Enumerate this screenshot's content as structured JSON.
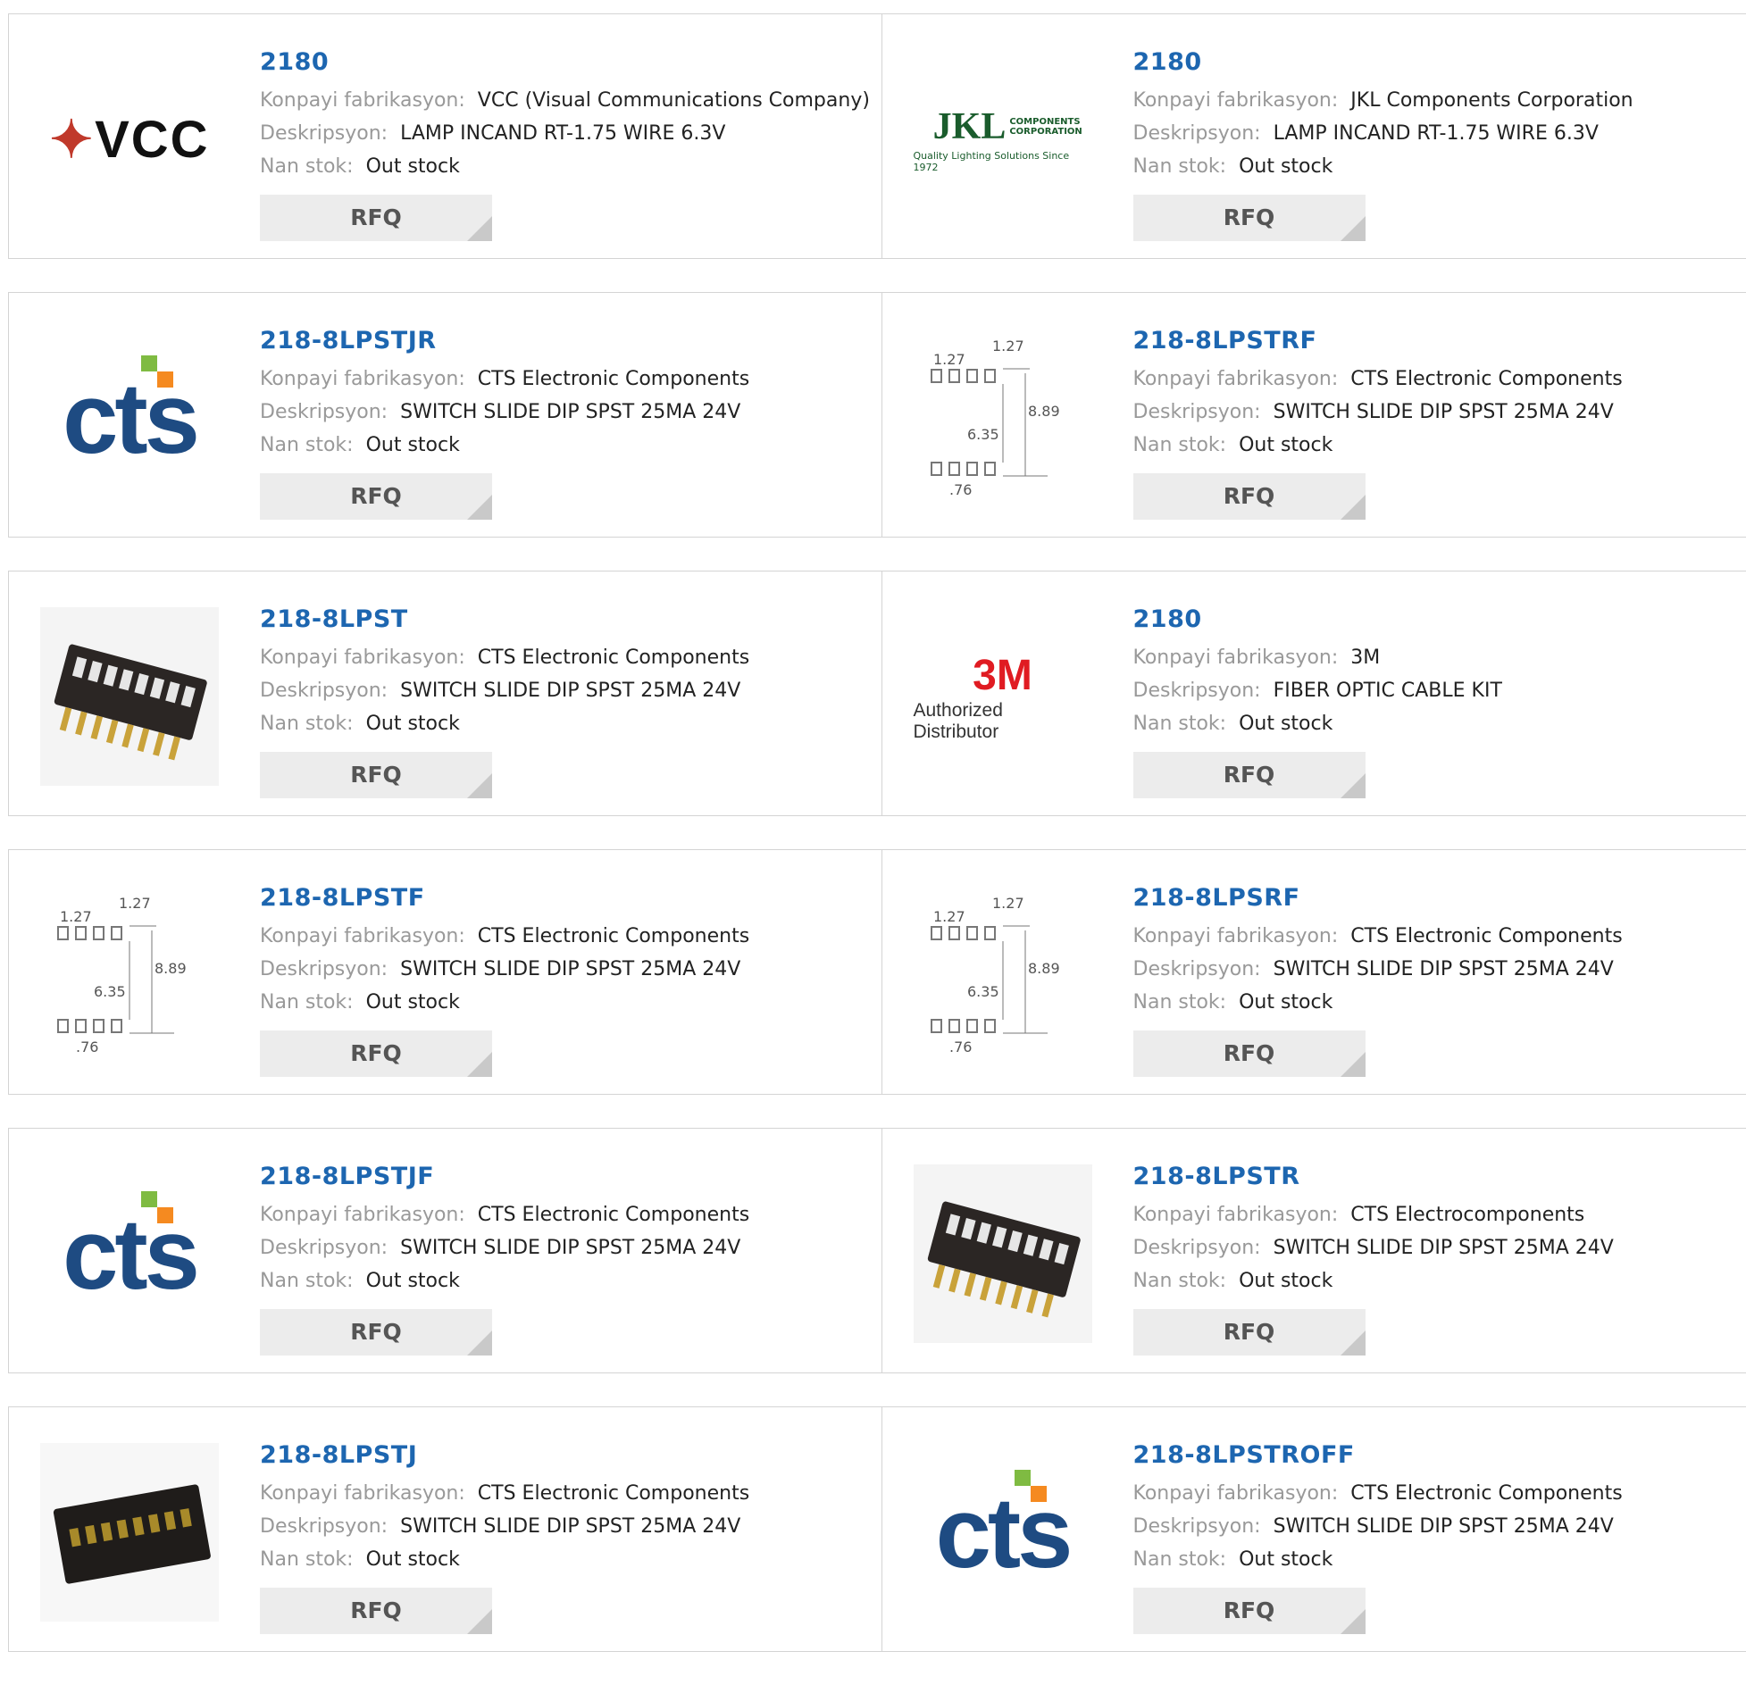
{
  "labels": {
    "manufacturer": "Konpayi fabrikasyon:",
    "description": "Deskripsyon:",
    "stock": "Nan stok:",
    "rfq": "RFQ"
  },
  "products": [
    {
      "part": "2180",
      "manufacturer": "VCC (Visual Communications Company)",
      "description": "LAMP INCAND RT-1.75 WIRE 6.3V",
      "stock": "Out stock",
      "image": "vcc-logo",
      "logo_text": "VCC"
    },
    {
      "part": "2180",
      "manufacturer": "JKL Components Corporation",
      "description": "LAMP INCAND RT-1.75 WIRE 6.3V",
      "stock": "Out stock",
      "image": "jkl-logo",
      "logo_text": "JKL",
      "logo_side": "COMPONENTS CORPORATION",
      "logo_sub": "Quality Lighting Solutions Since 1972"
    },
    {
      "part": "218-8LPSTJR",
      "manufacturer": "CTS Electronic Components",
      "description": "SWITCH SLIDE DIP SPST 25MA 24V",
      "stock": "Out stock",
      "image": "cts-logo",
      "logo_text": "cts"
    },
    {
      "part": "218-8LPSTRF",
      "manufacturer": "CTS Electronic Components",
      "description": "SWITCH SLIDE DIP SPST 25MA 24V",
      "stock": "Out stock",
      "image": "dimension-drawing",
      "dims": [
        "1.27",
        "1.27",
        "8.89",
        "6.35",
        ".76"
      ]
    },
    {
      "part": "218-8LPST",
      "manufacturer": "CTS Electronic Components",
      "description": "SWITCH SLIDE DIP SPST 25MA 24V",
      "stock": "Out stock",
      "image": "dip-switch-photo"
    },
    {
      "part": "2180",
      "manufacturer": "3M",
      "description": "FIBER OPTIC CABLE KIT",
      "stock": "Out stock",
      "image": "3m-logo",
      "logo_text": "3M",
      "logo_sub": "Authorized Distributor"
    },
    {
      "part": "218-8LPSTF",
      "manufacturer": "CTS Electronic Components",
      "description": "SWITCH SLIDE DIP SPST 25MA 24V",
      "stock": "Out stock",
      "image": "dimension-drawing",
      "dims": [
        "1.27",
        "1.27",
        "8.89",
        "6.35",
        ".76"
      ]
    },
    {
      "part": "218-8LPSRF",
      "manufacturer": "CTS Electronic Components",
      "description": "SWITCH SLIDE DIP SPST 25MA 24V",
      "stock": "Out stock",
      "image": "dimension-drawing",
      "dims": [
        "1.27",
        "1.27",
        "8.89",
        "6.35",
        ".76"
      ]
    },
    {
      "part": "218-8LPSTJF",
      "manufacturer": "CTS Electronic Components",
      "description": "SWITCH SLIDE DIP SPST 25MA 24V",
      "stock": "Out stock",
      "image": "cts-logo",
      "logo_text": "cts"
    },
    {
      "part": "218-8LPSTR",
      "manufacturer": "CTS Electrocomponents",
      "description": "SWITCH SLIDE DIP SPST 25MA 24V",
      "stock": "Out stock",
      "image": "dip-switch-photo"
    },
    {
      "part": "218-8LPSTJ",
      "manufacturer": "CTS Electronic Components",
      "description": "SWITCH SLIDE DIP SPST 25MA 24V",
      "stock": "Out stock",
      "image": "dip-switch-dark-photo"
    },
    {
      "part": "218-8LPSTROFF",
      "manufacturer": "CTS Electronic Components",
      "description": "SWITCH SLIDE DIP SPST 25MA 24V",
      "stock": "Out stock",
      "image": "cts-logo",
      "logo_text": "cts"
    }
  ],
  "colors": {
    "part_link": "#1d66b0",
    "label": "#999999",
    "button_bg": "#ececec",
    "cts_blue": "#1e4b82",
    "cts_green": "#7fbb42",
    "cts_orange": "#f58a20",
    "m3_red": "#e01b22",
    "jkl_green": "#1a5c2c"
  }
}
